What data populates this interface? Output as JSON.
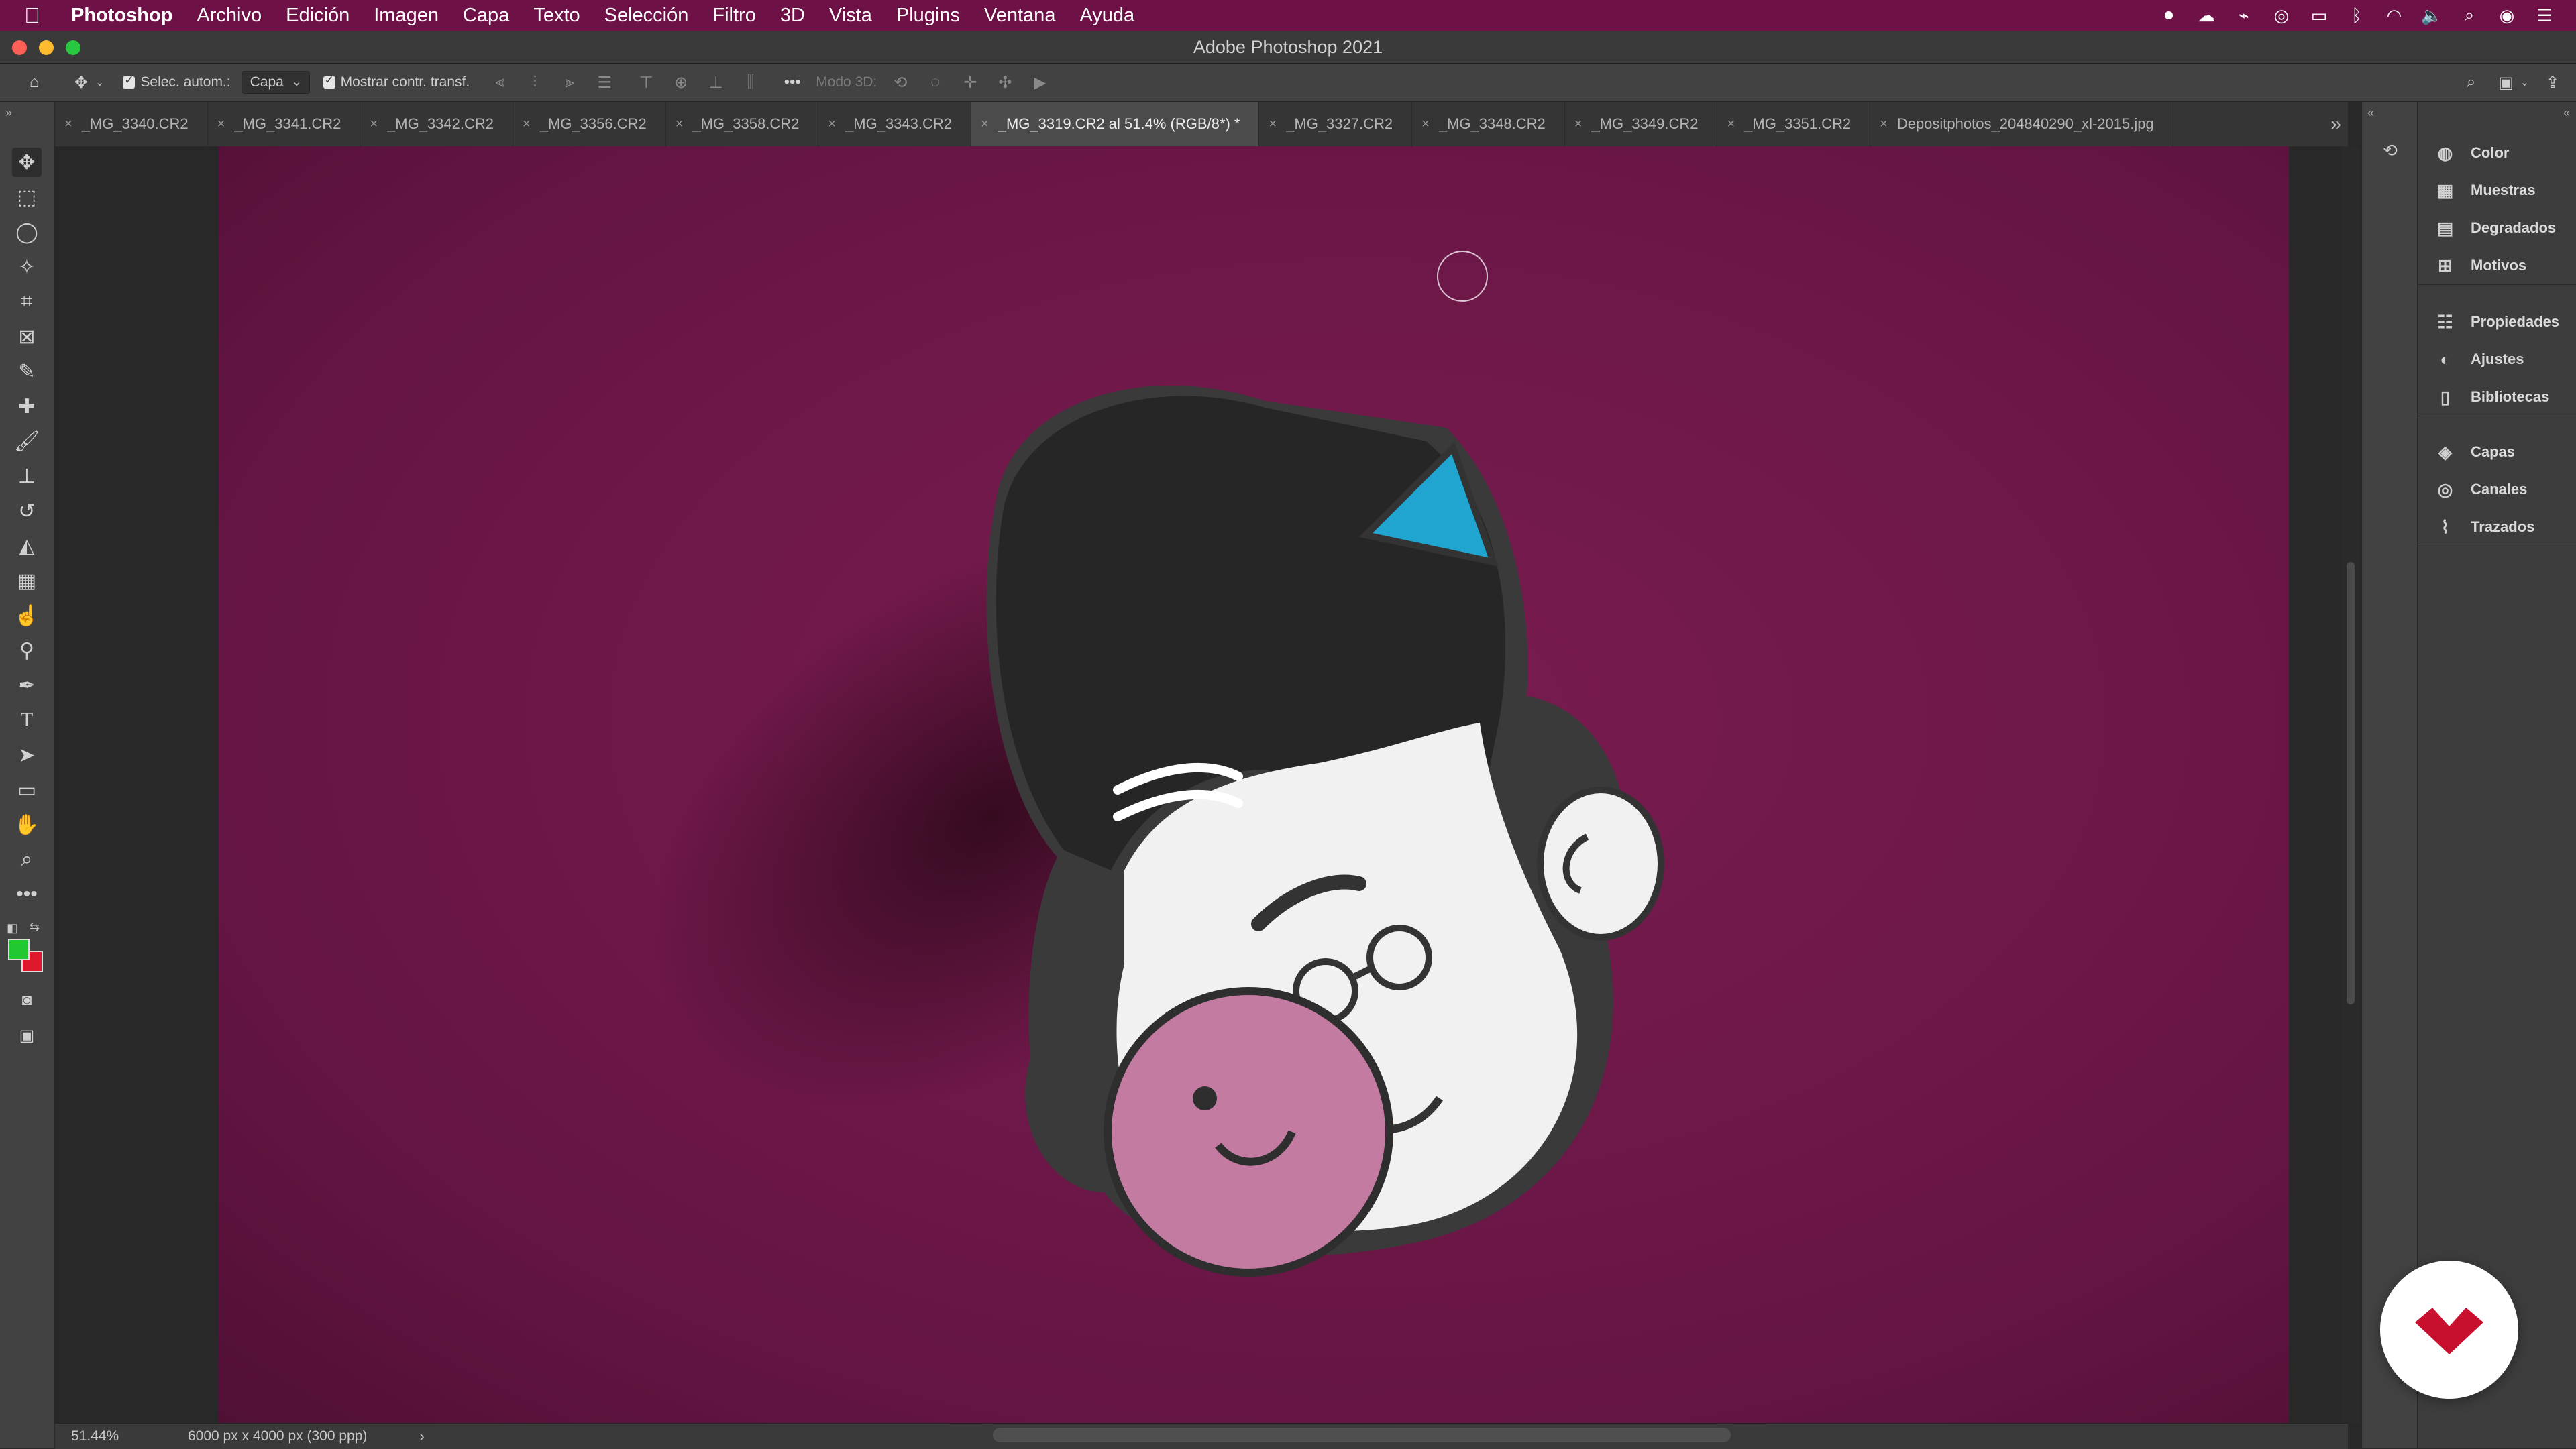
{
  "menubar": {
    "app_name": "Photoshop",
    "items": [
      "Archivo",
      "Edición",
      "Imagen",
      "Capa",
      "Texto",
      "Selección",
      "Filtro",
      "3D",
      "Vista",
      "Plugins",
      "Ventana",
      "Ayuda"
    ]
  },
  "window": {
    "title": "Adobe Photoshop 2021"
  },
  "options": {
    "auto_select_label": "Selec. autom.:",
    "auto_select_value": "Capa",
    "show_transform_label": "Mostrar contr. transf.",
    "mode3d_label": "Modo 3D:"
  },
  "tabs": [
    "_MG_3340.CR2",
    "_MG_3341.CR2",
    "_MG_3342.CR2",
    "_MG_3356.CR2",
    "_MG_3358.CR2",
    "_MG_3343.CR2",
    "_MG_3319.CR2 al 51.4% (RGB/8*) *",
    "_MG_3327.CR2",
    "_MG_3348.CR2",
    "_MG_3349.CR2",
    "_MG_3351.CR2",
    "Depositphotos_204840290_xl-2015.jpg"
  ],
  "status": {
    "zoom": "51.44%",
    "doc_size": "6000 px x 4000 px (300 ppp)"
  },
  "panels": {
    "group1": [
      "Color",
      "Muestras",
      "Degradados",
      "Motivos"
    ],
    "group2": [
      "Propiedades",
      "Ajustes",
      "Bibliotecas"
    ],
    "group3": [
      "Capas",
      "Canales",
      "Trazados"
    ]
  },
  "colors": {
    "menubar": "#6d1147",
    "foreground": "#22c832",
    "background": "#e0182c",
    "photo_bg": "#6a1745",
    "brand": "#c8102e"
  }
}
